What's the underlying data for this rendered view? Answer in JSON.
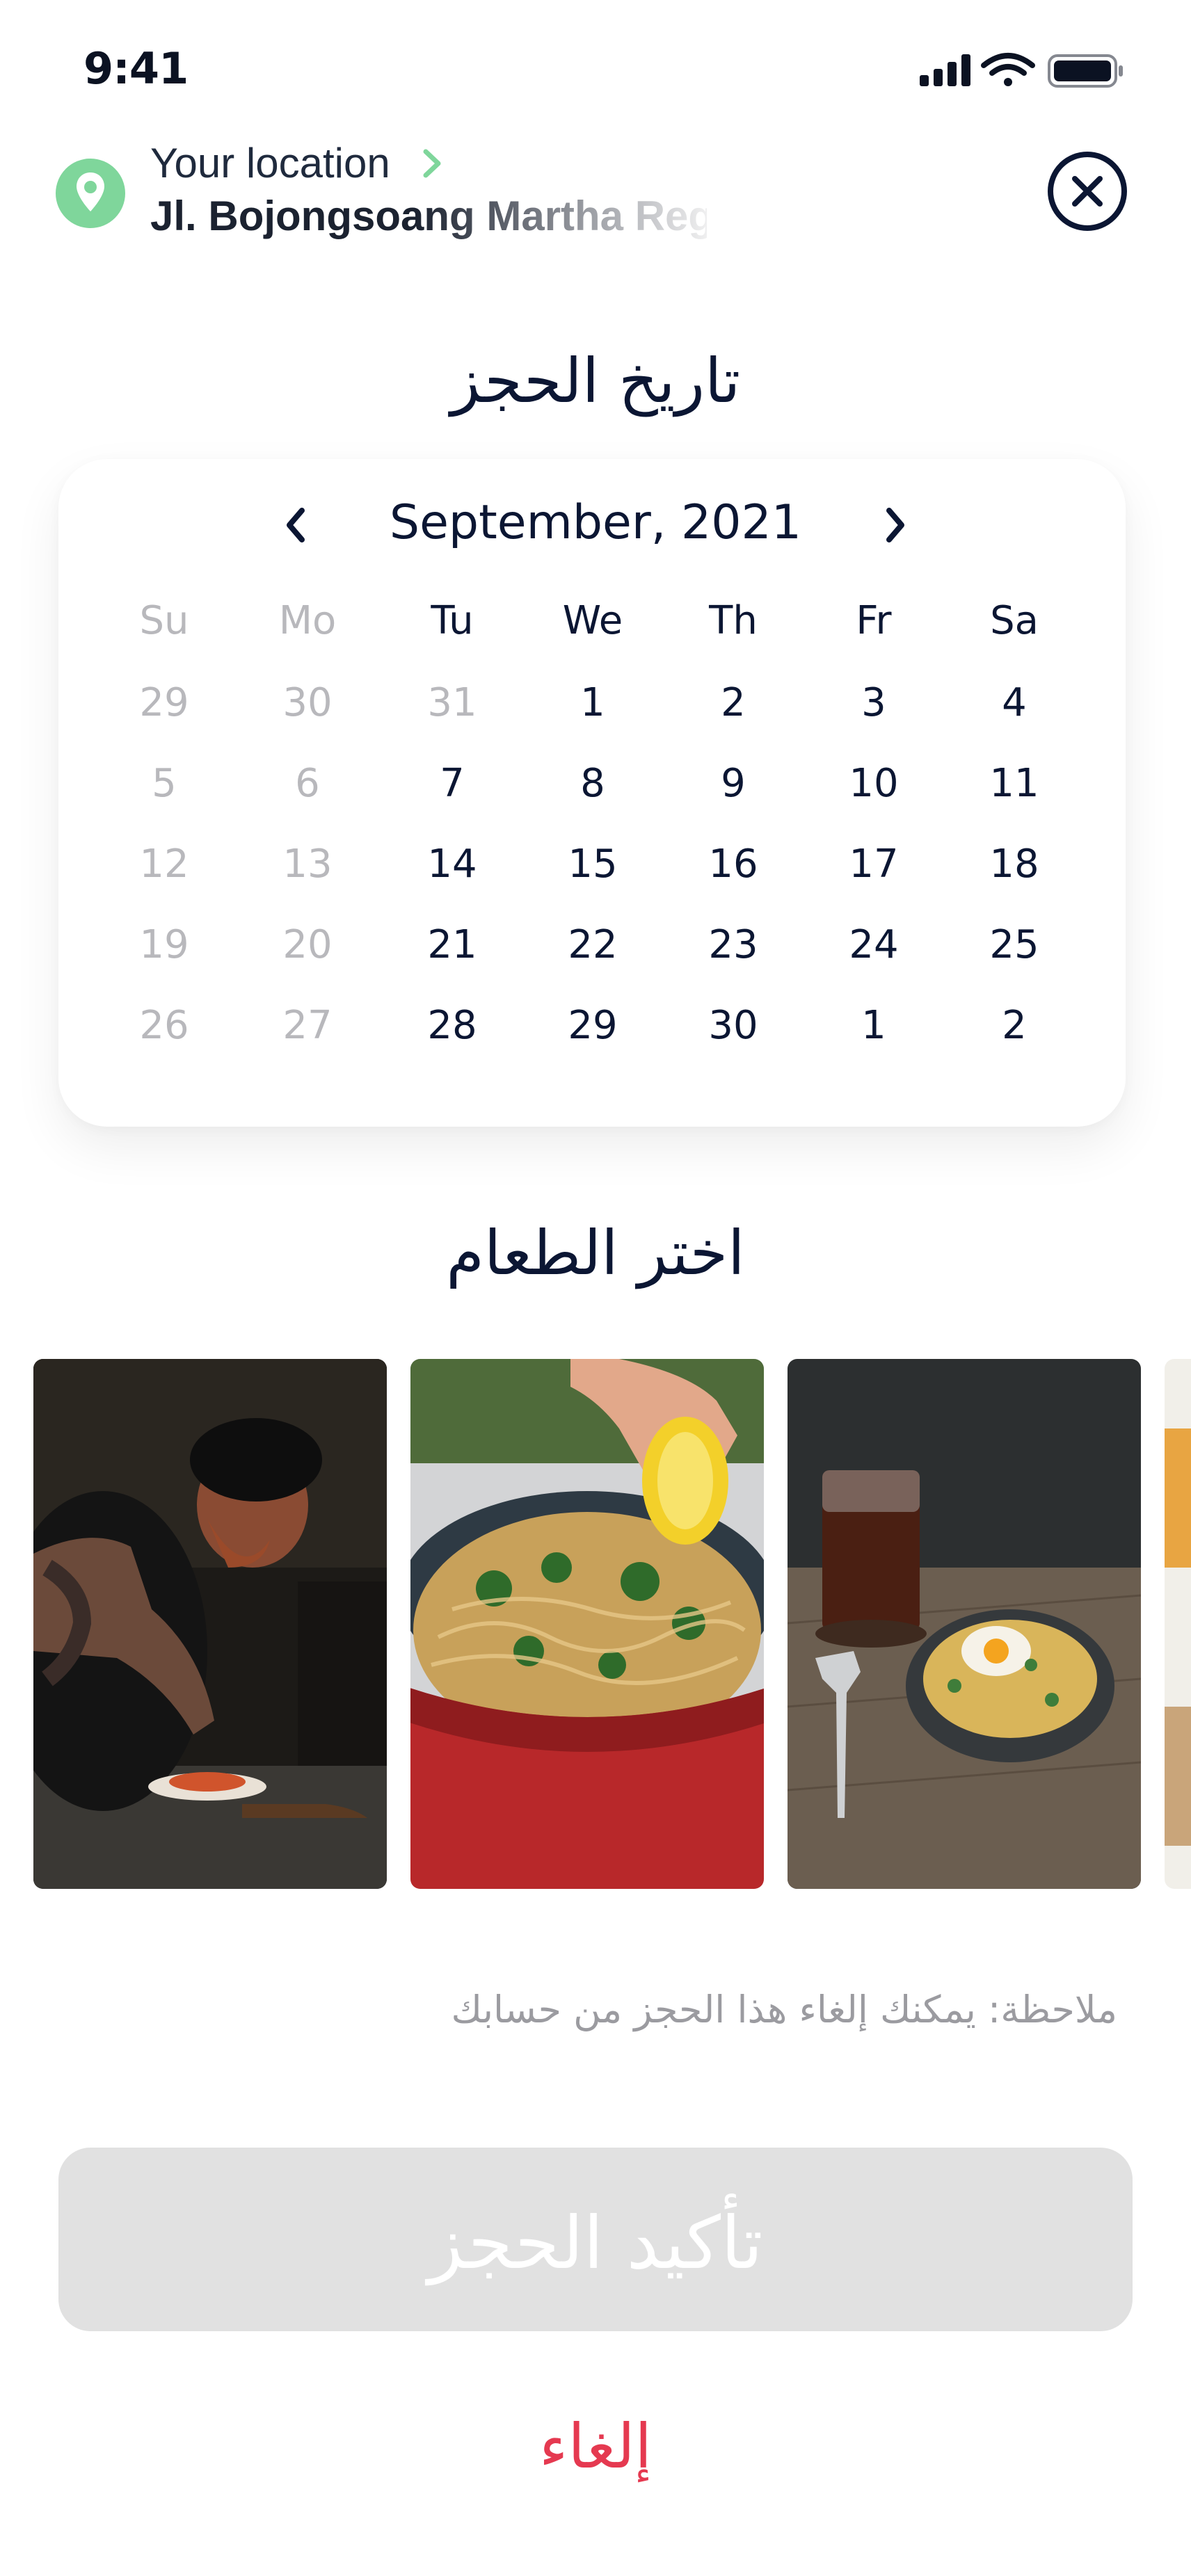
{
  "status_bar": {
    "time": "9:41",
    "icons": [
      "cellular-signal-icon",
      "wifi-icon",
      "battery-icon"
    ]
  },
  "location": {
    "label": "Your location",
    "address": "Jl. Bojongsoang Martha Reg",
    "pin_color": "#7fd69b",
    "chevron_color": "#7fd69b"
  },
  "booking_date": {
    "title": "تاريخ الحجز",
    "month_label": "September, 2021",
    "weekdays": [
      "Su",
      "Mo",
      "Tu",
      "We",
      "Th",
      "Fr",
      "Sa"
    ],
    "weeks": [
      [
        "29",
        "30",
        "31",
        "1",
        "2",
        "3",
        "4"
      ],
      [
        "5",
        "6",
        "7",
        "8",
        "9",
        "10",
        "11"
      ],
      [
        "12",
        "13",
        "14",
        "15",
        "16",
        "17",
        "18"
      ],
      [
        "19",
        "20",
        "21",
        "22",
        "23",
        "24",
        "25"
      ],
      [
        "26",
        "27",
        "28",
        "29",
        "30",
        "1",
        "2"
      ]
    ]
  },
  "food": {
    "title": "اختر الطعام",
    "photos": [
      "chef plating a dish",
      "noodles in red pan with lemon",
      "bowl of noodles with fried egg and iced tea",
      "partial food photo"
    ]
  },
  "note": "ملاحظة: يمكنك إلغاء هذا الحجز من حسابك",
  "confirm_button": "تأكيد الحجز",
  "cancel_link": "إلغاء",
  "colors": {
    "accent_red": "#e53950",
    "disabled_button": "#e1e1e1",
    "muted_text": "#b8b8bc",
    "primary_text": "#0b1633"
  }
}
